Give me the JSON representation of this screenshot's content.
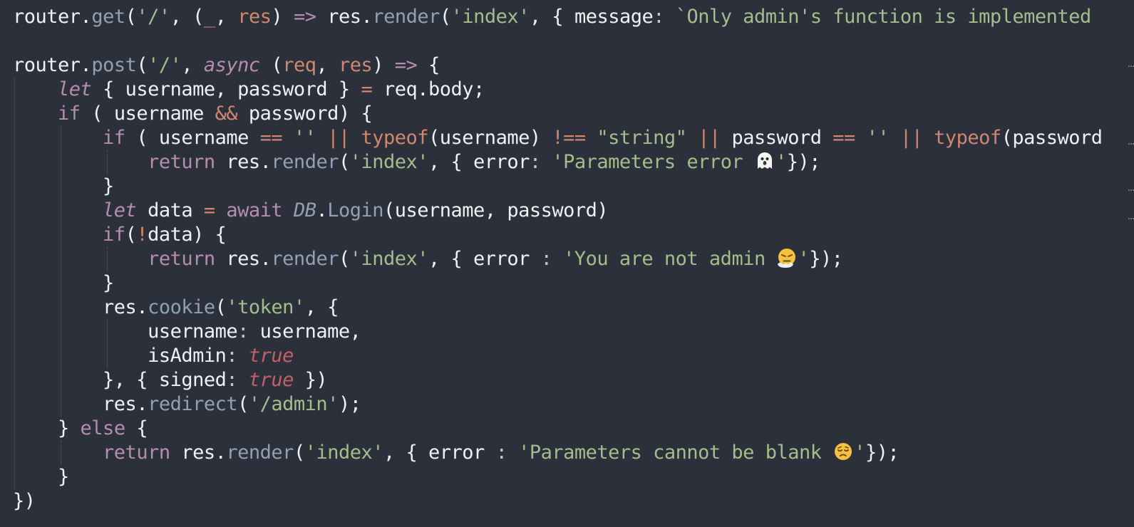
{
  "editor": {
    "background": "#2b303b",
    "colors": {
      "text": "#eff1f5",
      "function": "#8fa1b3",
      "string": "#a3be8c",
      "parameter": "#d08770",
      "keyword": "#b48ead",
      "constant": "#bf616a"
    },
    "lines": [
      {
        "tokens": [
          {
            "t": "router",
            "c": "plain"
          },
          {
            "t": ".",
            "c": "punct"
          },
          {
            "t": "get",
            "c": "fn"
          },
          {
            "t": "(",
            "c": "punct"
          },
          {
            "t": "'/'",
            "c": "str"
          },
          {
            "t": ", (",
            "c": "punct"
          },
          {
            "t": "_",
            "c": "param"
          },
          {
            "t": ", ",
            "c": "punct"
          },
          {
            "t": "res",
            "c": "param"
          },
          {
            "t": ") ",
            "c": "punct"
          },
          {
            "t": "=>",
            "c": "kw"
          },
          {
            "t": " res",
            "c": "plain"
          },
          {
            "t": ".",
            "c": "punct"
          },
          {
            "t": "render",
            "c": "fn"
          },
          {
            "t": "(",
            "c": "punct"
          },
          {
            "t": "'index'",
            "c": "str"
          },
          {
            "t": ", { message",
            "c": "plain"
          },
          {
            "t": ": ",
            "c": "op"
          },
          {
            "t": "`Only admin's function is implemented",
            "c": "str"
          }
        ]
      },
      {
        "tokens": []
      },
      {
        "tokens": [
          {
            "t": "router",
            "c": "plain"
          },
          {
            "t": ".",
            "c": "punct"
          },
          {
            "t": "post",
            "c": "fn"
          },
          {
            "t": "(",
            "c": "punct"
          },
          {
            "t": "'/'",
            "c": "str"
          },
          {
            "t": ", ",
            "c": "punct"
          },
          {
            "t": "async",
            "c": "kw italic"
          },
          {
            "t": " (",
            "c": "punct"
          },
          {
            "t": "req",
            "c": "param"
          },
          {
            "t": ", ",
            "c": "punct"
          },
          {
            "t": "res",
            "c": "param"
          },
          {
            "t": ") ",
            "c": "punct"
          },
          {
            "t": "=>",
            "c": "kw"
          },
          {
            "t": " {",
            "c": "punct"
          }
        ]
      },
      {
        "tokens": [
          {
            "t": "    ",
            "c": "plain"
          },
          {
            "t": "let",
            "c": "kw italic"
          },
          {
            "t": " { username, password } ",
            "c": "plain"
          },
          {
            "t": "=",
            "c": "param"
          },
          {
            "t": " req",
            "c": "plain"
          },
          {
            "t": ".",
            "c": "punct"
          },
          {
            "t": "body;",
            "c": "plain"
          }
        ]
      },
      {
        "tokens": [
          {
            "t": "    ",
            "c": "plain"
          },
          {
            "t": "if",
            "c": "kw"
          },
          {
            "t": " ( username ",
            "c": "plain"
          },
          {
            "t": "&&",
            "c": "param"
          },
          {
            "t": " password) {",
            "c": "plain"
          }
        ]
      },
      {
        "tokens": [
          {
            "t": "        ",
            "c": "plain"
          },
          {
            "t": "if",
            "c": "kw"
          },
          {
            "t": " ( username ",
            "c": "plain"
          },
          {
            "t": "==",
            "c": "param"
          },
          {
            "t": " ",
            "c": "plain"
          },
          {
            "t": "''",
            "c": "str"
          },
          {
            "t": " ",
            "c": "plain"
          },
          {
            "t": "||",
            "c": "param"
          },
          {
            "t": " ",
            "c": "plain"
          },
          {
            "t": "typeof",
            "c": "param"
          },
          {
            "t": "(username) ",
            "c": "plain"
          },
          {
            "t": "!==",
            "c": "param"
          },
          {
            "t": " ",
            "c": "plain"
          },
          {
            "t": "\"string\"",
            "c": "str"
          },
          {
            "t": " ",
            "c": "plain"
          },
          {
            "t": "||",
            "c": "param"
          },
          {
            "t": " password ",
            "c": "plain"
          },
          {
            "t": "==",
            "c": "param"
          },
          {
            "t": " ",
            "c": "plain"
          },
          {
            "t": "''",
            "c": "str"
          },
          {
            "t": " ",
            "c": "plain"
          },
          {
            "t": "||",
            "c": "param"
          },
          {
            "t": " ",
            "c": "plain"
          },
          {
            "t": "typeof",
            "c": "param"
          },
          {
            "t": "(password",
            "c": "plain"
          }
        ]
      },
      {
        "tokens": [
          {
            "t": "            ",
            "c": "plain"
          },
          {
            "t": "return",
            "c": "kw"
          },
          {
            "t": " res",
            "c": "plain"
          },
          {
            "t": ".",
            "c": "punct"
          },
          {
            "t": "render",
            "c": "fn"
          },
          {
            "t": "(",
            "c": "punct"
          },
          {
            "t": "'index'",
            "c": "str"
          },
          {
            "t": ", { error",
            "c": "plain"
          },
          {
            "t": ": ",
            "c": "op"
          },
          {
            "t": "'Parameters error ",
            "c": "str"
          },
          {
            "emoji": "ghost-emoji"
          },
          {
            "t": "'",
            "c": "str"
          },
          {
            "t": "});",
            "c": "plain"
          }
        ]
      },
      {
        "tokens": [
          {
            "t": "        }",
            "c": "plain"
          }
        ]
      },
      {
        "tokens": [
          {
            "t": "        ",
            "c": "plain"
          },
          {
            "t": "let",
            "c": "kw italic"
          },
          {
            "t": " data ",
            "c": "plain"
          },
          {
            "t": "=",
            "c": "param"
          },
          {
            "t": " ",
            "c": "plain"
          },
          {
            "t": "await",
            "c": "kw"
          },
          {
            "t": " ",
            "c": "plain"
          },
          {
            "t": "DB",
            "c": "fn italic"
          },
          {
            "t": ".",
            "c": "punct"
          },
          {
            "t": "Login",
            "c": "fn"
          },
          {
            "t": "(username, password)",
            "c": "plain"
          }
        ]
      },
      {
        "tokens": [
          {
            "t": "        ",
            "c": "plain"
          },
          {
            "t": "if",
            "c": "kw"
          },
          {
            "t": "(",
            "c": "plain"
          },
          {
            "t": "!",
            "c": "param"
          },
          {
            "t": "data) {",
            "c": "plain"
          }
        ]
      },
      {
        "tokens": [
          {
            "t": "            ",
            "c": "plain"
          },
          {
            "t": "return",
            "c": "kw"
          },
          {
            "t": " res",
            "c": "plain"
          },
          {
            "t": ".",
            "c": "punct"
          },
          {
            "t": "render",
            "c": "fn"
          },
          {
            "t": "(",
            "c": "punct"
          },
          {
            "t": "'index'",
            "c": "str"
          },
          {
            "t": ", { error ",
            "c": "plain"
          },
          {
            "t": ": ",
            "c": "op"
          },
          {
            "t": "'You are not admin ",
            "c": "str"
          },
          {
            "emoji": "steam-face-emoji"
          },
          {
            "t": "'",
            "c": "str"
          },
          {
            "t": "});",
            "c": "plain"
          }
        ]
      },
      {
        "tokens": [
          {
            "t": "        }",
            "c": "plain"
          }
        ]
      },
      {
        "tokens": [
          {
            "t": "        res",
            "c": "plain"
          },
          {
            "t": ".",
            "c": "punct"
          },
          {
            "t": "cookie",
            "c": "fn"
          },
          {
            "t": "(",
            "c": "punct"
          },
          {
            "t": "'token'",
            "c": "str"
          },
          {
            "t": ", {",
            "c": "plain"
          }
        ]
      },
      {
        "tokens": [
          {
            "t": "            username",
            "c": "plain"
          },
          {
            "t": ": ",
            "c": "op"
          },
          {
            "t": "username,",
            "c": "plain"
          }
        ]
      },
      {
        "tokens": [
          {
            "t": "            isAdmin",
            "c": "plain"
          },
          {
            "t": ": ",
            "c": "op"
          },
          {
            "t": "true",
            "c": "red italic"
          }
        ]
      },
      {
        "tokens": [
          {
            "t": "        }, { signed",
            "c": "plain"
          },
          {
            "t": ": ",
            "c": "op"
          },
          {
            "t": "true",
            "c": "red italic"
          },
          {
            "t": " })",
            "c": "plain"
          }
        ]
      },
      {
        "tokens": [
          {
            "t": "        res",
            "c": "plain"
          },
          {
            "t": ".",
            "c": "punct"
          },
          {
            "t": "redirect",
            "c": "fn"
          },
          {
            "t": "(",
            "c": "punct"
          },
          {
            "t": "'/admin'",
            "c": "str"
          },
          {
            "t": ");",
            "c": "plain"
          }
        ]
      },
      {
        "tokens": [
          {
            "t": "    } ",
            "c": "plain"
          },
          {
            "t": "else",
            "c": "kw"
          },
          {
            "t": " {",
            "c": "plain"
          }
        ]
      },
      {
        "tokens": [
          {
            "t": "        ",
            "c": "plain"
          },
          {
            "t": "return",
            "c": "kw"
          },
          {
            "t": " res",
            "c": "plain"
          },
          {
            "t": ".",
            "c": "punct"
          },
          {
            "t": "render",
            "c": "fn"
          },
          {
            "t": "(",
            "c": "punct"
          },
          {
            "t": "'index'",
            "c": "str"
          },
          {
            "t": ", { error ",
            "c": "plain"
          },
          {
            "t": ": ",
            "c": "op"
          },
          {
            "t": "'Parameters cannot be blank ",
            "c": "str"
          },
          {
            "emoji": "pensive-face-emoji"
          },
          {
            "t": "'",
            "c": "str"
          },
          {
            "t": "});",
            "c": "plain"
          }
        ]
      },
      {
        "tokens": [
          {
            "t": "    }",
            "c": "plain"
          }
        ]
      },
      {
        "tokens": [
          {
            "t": "})",
            "c": "plain"
          }
        ]
      }
    ]
  }
}
